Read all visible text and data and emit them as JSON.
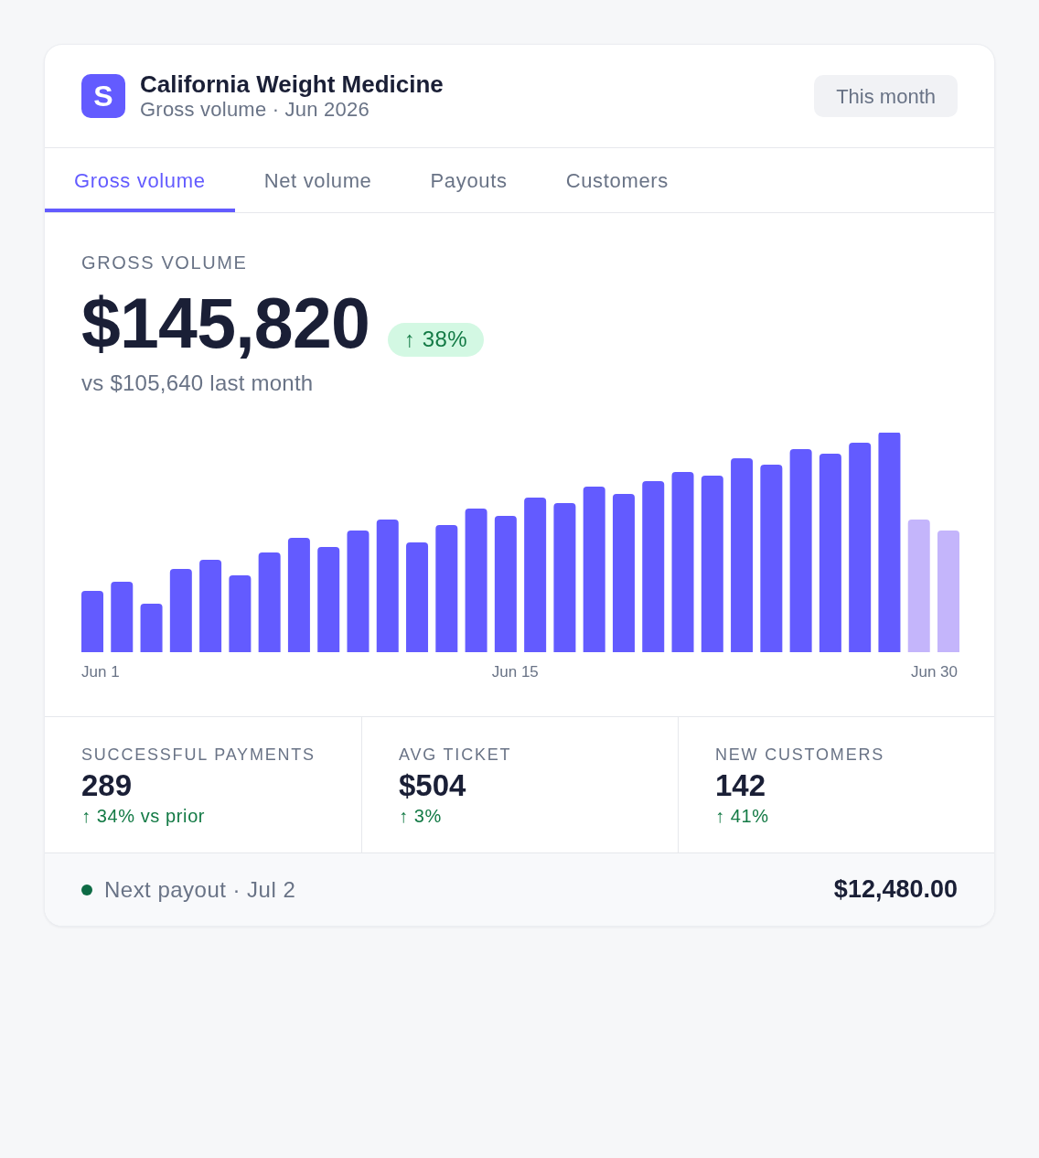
{
  "header": {
    "logo_letter": "S",
    "title": "California Weight Medicine",
    "subtitle": "Gross volume · Jun 2026",
    "period_button": "This month"
  },
  "tabs": [
    {
      "label": "Gross volume",
      "selected": true
    },
    {
      "label": "Net volume",
      "selected": false
    },
    {
      "label": "Payouts",
      "selected": false
    },
    {
      "label": "Customers",
      "selected": false
    }
  ],
  "summary": {
    "label": "GROSS VOLUME",
    "amount": "$145,820",
    "change": {
      "text": "↑ 38%",
      "rising": true
    },
    "comparison": "vs $105,640 last month"
  },
  "chart": {
    "x_labels": [
      "Jun 1",
      "Jun 15",
      "Jun 30"
    ]
  },
  "stats": [
    {
      "label": "SUCCESSFUL PAYMENTS",
      "value": "289",
      "change": "↑ 34% vs prior",
      "rising": true
    },
    {
      "label": "AVG TICKET",
      "value": "$504",
      "change": "↑ 3%",
      "rising": true
    },
    {
      "label": "NEW CUSTOMERS",
      "value": "142",
      "change": "↑ 41%",
      "rising": true
    }
  ],
  "footer": {
    "payout_label": "Next payout · Jul 2",
    "payout_amount": "$12,480.00"
  }
}
